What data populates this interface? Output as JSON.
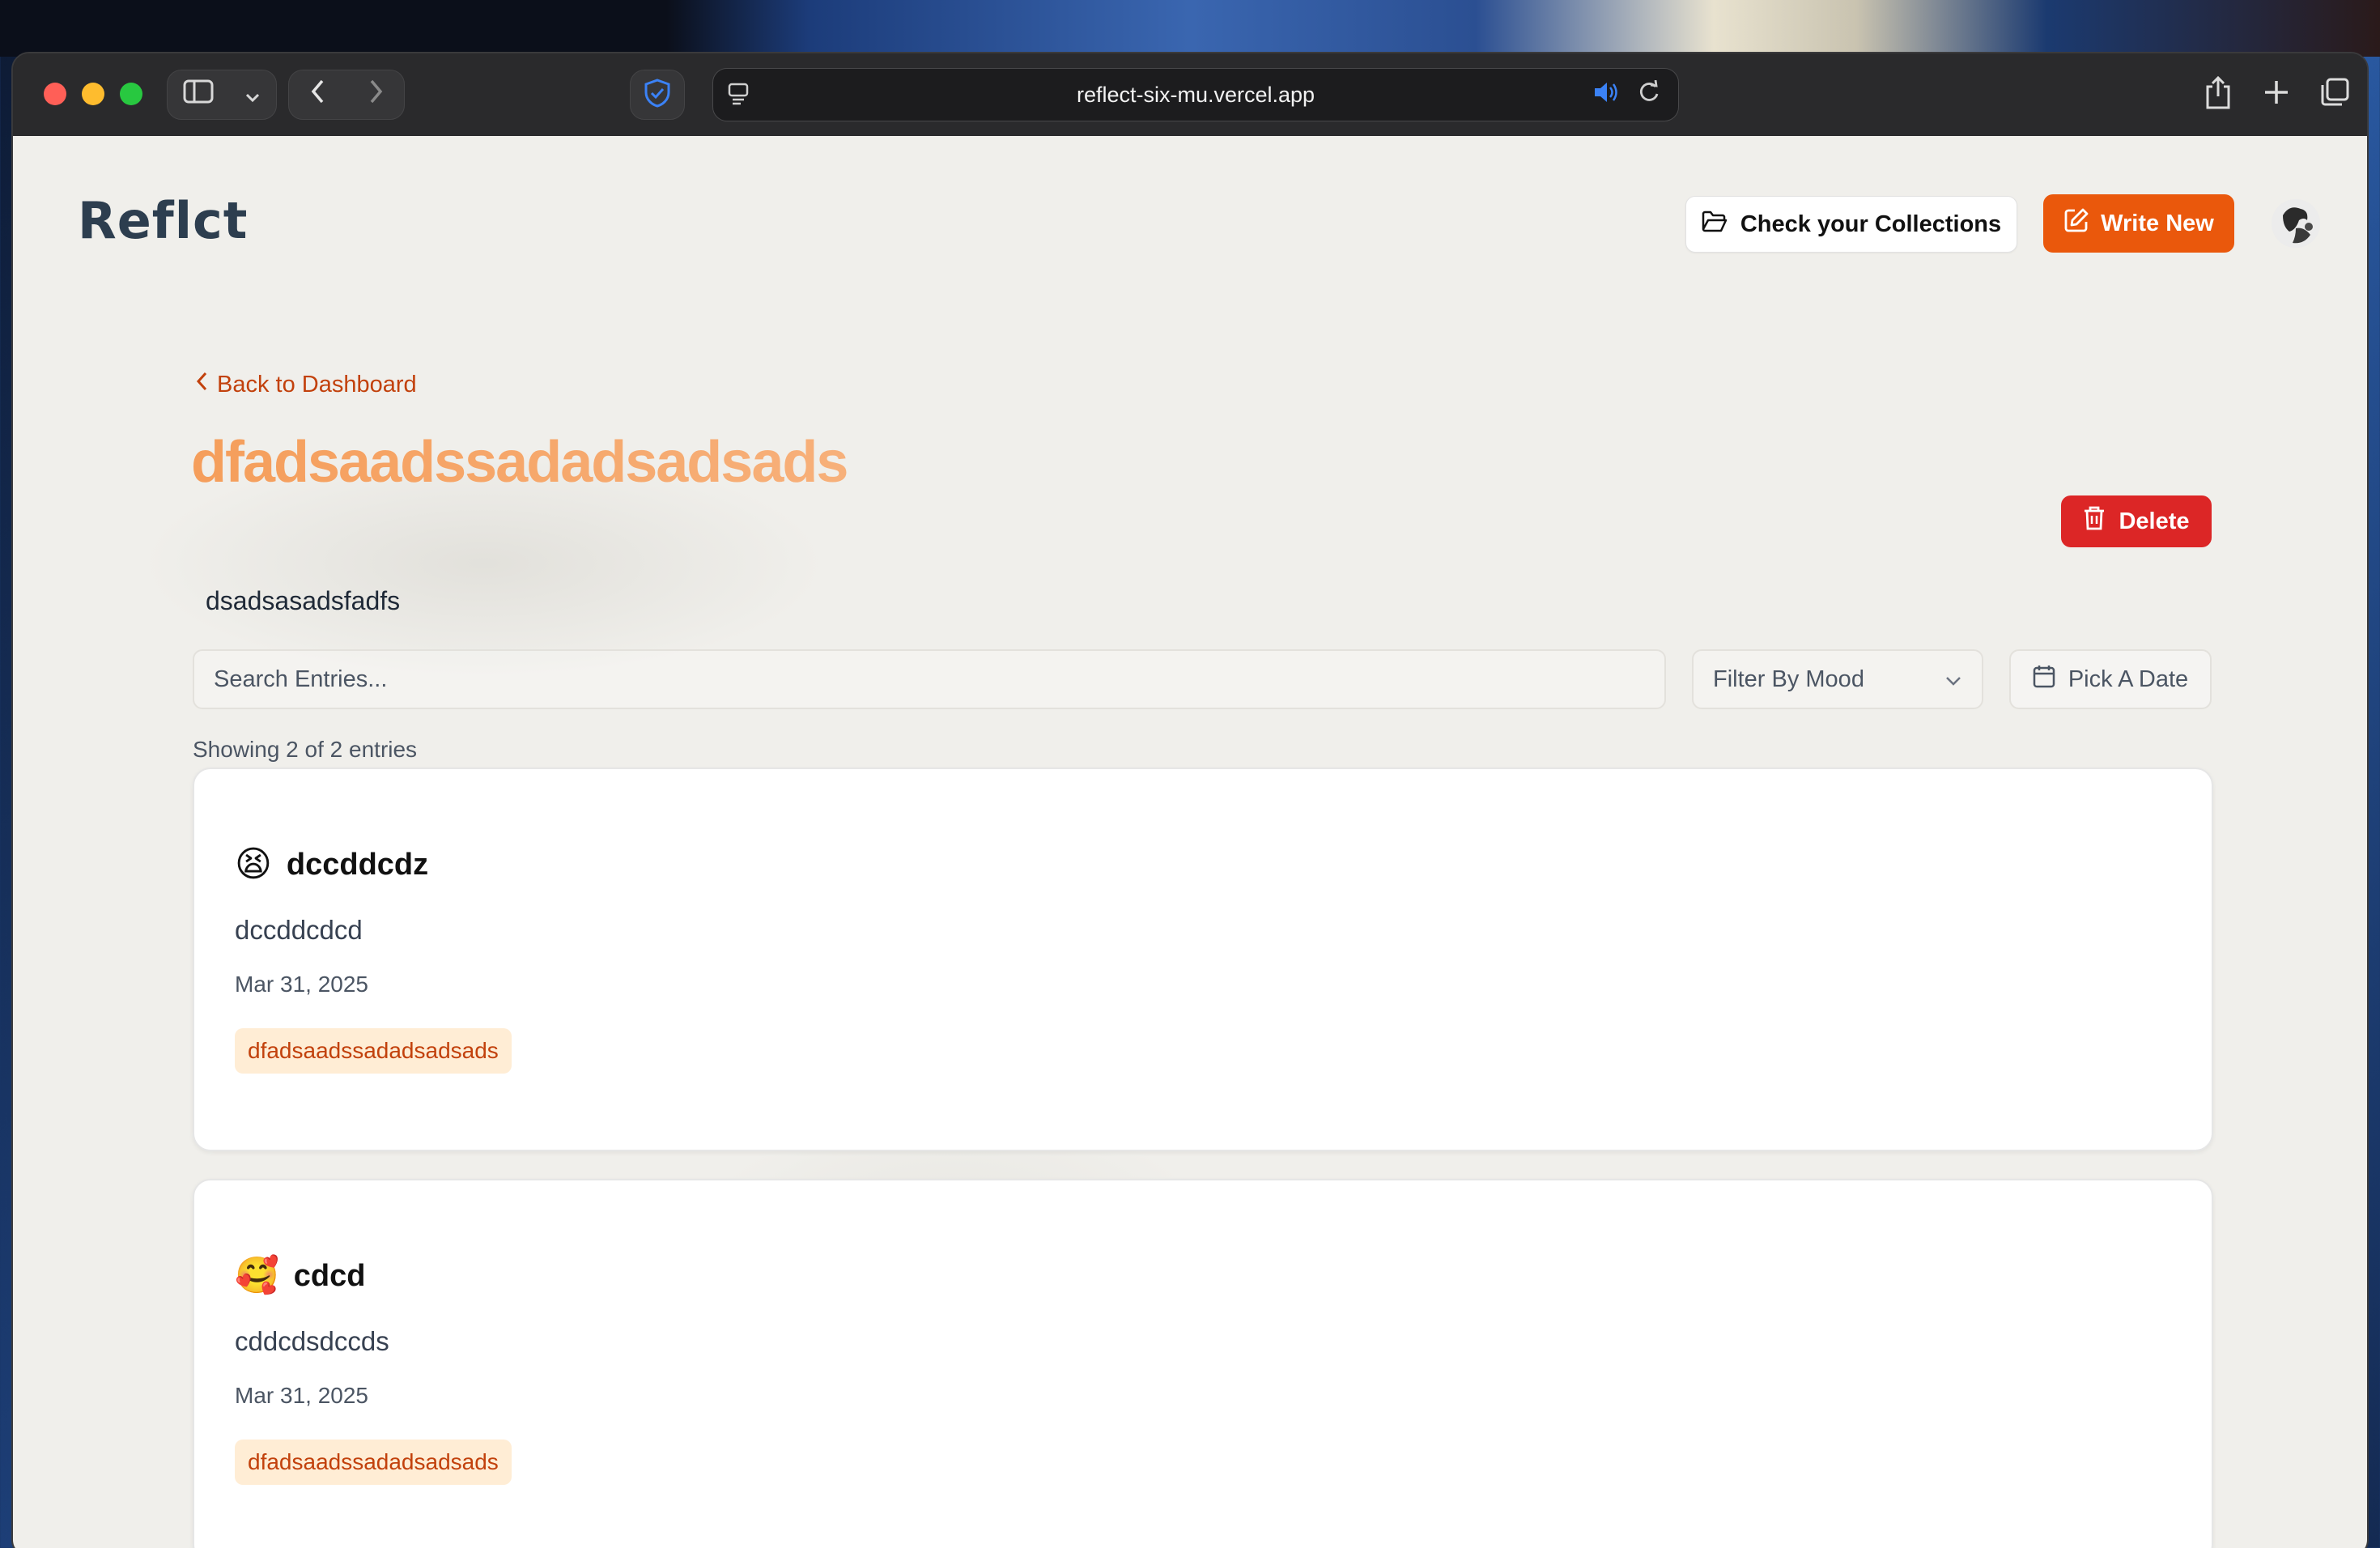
{
  "browser": {
    "url": "reflect-six-mu.vercel.app"
  },
  "header": {
    "logo": "Reflct",
    "collections_label": "Check your Collections",
    "write_new_label": "Write New"
  },
  "collection": {
    "back_label": "Back to Dashboard",
    "title": "dfadsaadssadadsadsads",
    "description": "dsadsasadsfadfs",
    "delete_label": "Delete"
  },
  "filters": {
    "search_placeholder": "Search Entries...",
    "mood_label": "Filter By Mood",
    "date_label": "Pick A Date"
  },
  "summary": {
    "showing_text": "Showing 2 of 2 entries"
  },
  "entries": [
    {
      "emoji": "😫",
      "title": "dccddcdz",
      "body": "dccddcdcd",
      "date": "Mar 31, 2025",
      "tag": "dfadsaadssadadsadsads"
    },
    {
      "emoji": "🥰",
      "title": "cdcd",
      "body": "cddcdsdccds",
      "date": "Mar 31, 2025",
      "tag": "dfadsaadssadadsadsads"
    }
  ],
  "colors": {
    "accent": "#ea580c",
    "danger": "#dc2626",
    "tag_bg": "#ffedd5",
    "tag_text": "#c2410c"
  }
}
